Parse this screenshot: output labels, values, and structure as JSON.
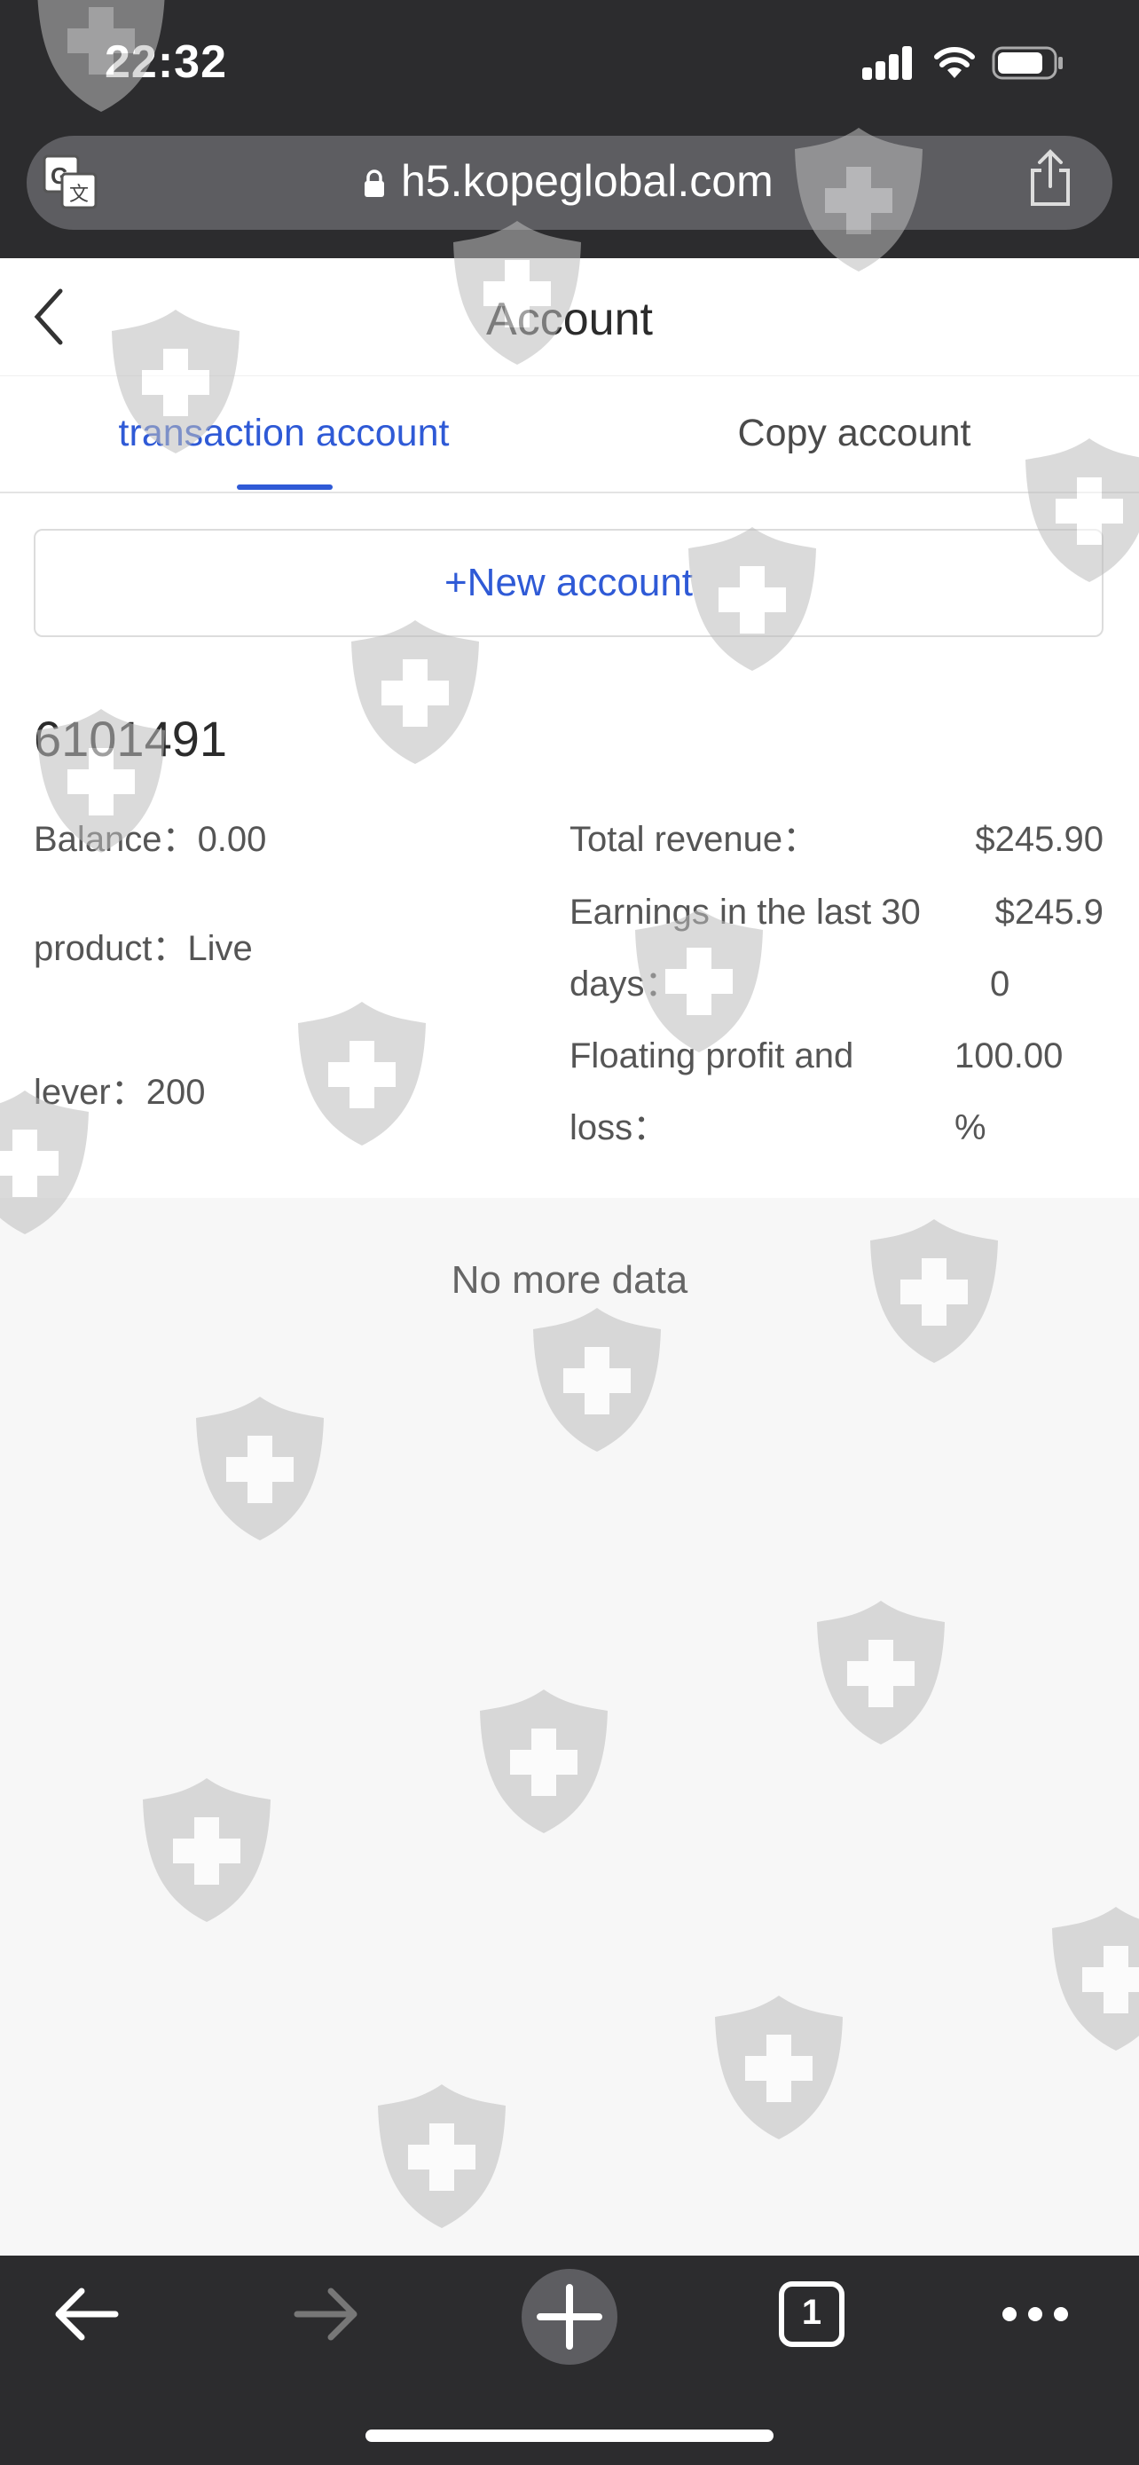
{
  "status_bar": {
    "time": "22:32"
  },
  "browser": {
    "url": "h5.kopeglobal.com",
    "tab_count": "1"
  },
  "header": {
    "title": "Account"
  },
  "tabs": [
    {
      "label": "transaction account",
      "active": true
    },
    {
      "label": "Copy account",
      "active": false
    }
  ],
  "new_account_label": "+New account",
  "account": {
    "number": "6101491",
    "balance": {
      "label": "Balance：",
      "value": "0.00"
    },
    "product": {
      "label": "product：",
      "value": "Live"
    },
    "lever": {
      "label": "lever：",
      "value": "200"
    },
    "total_revenue": {
      "label": "Total revenue：",
      "value": "$245.90"
    },
    "earnings_30": {
      "label_line1": "Earnings in the last 30",
      "label_line2": "days：",
      "value_line1": "$245.9",
      "value_line2": "0"
    },
    "floating": {
      "label_line1": "Floating profit and",
      "label_line2": "loss：",
      "value_line1": "100.00",
      "value_line2": "%"
    }
  },
  "footer_text": "No more data",
  "colors": {
    "accent": "#2f5ad6",
    "chrome": "#2c2c2e",
    "background": "#f7f7f7"
  },
  "icons": [
    "translate-icon",
    "lock-icon",
    "share-icon",
    "back-icon",
    "shield-watermark-icon",
    "arrow-left-icon",
    "arrow-right-icon",
    "plus-icon",
    "tabs-icon",
    "more-icon"
  ]
}
